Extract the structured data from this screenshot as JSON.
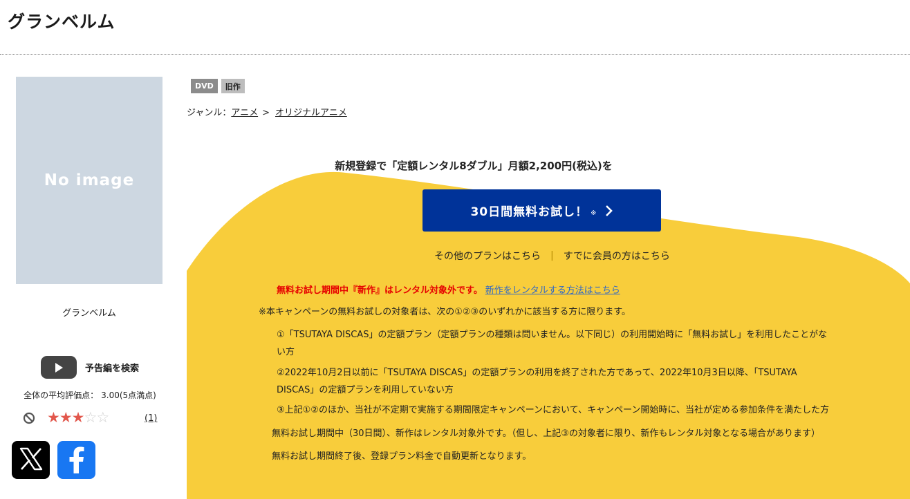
{
  "header": {
    "title": "グランベルム"
  },
  "product": {
    "no_image_text": "No image",
    "name": "グランベルム",
    "trailer_label": "予告編を検索",
    "avg_rating_label": "全体の平均評価点：",
    "avg_rating_value": "3.00(5点満点)",
    "rating": 3,
    "rating_max": 5,
    "review_count": "(1)"
  },
  "badges": {
    "format": "DVD",
    "age": "旧作"
  },
  "genre": {
    "label": "ジャンル：",
    "level1": "アニメ",
    "separator": ">",
    "level2": "オリジナルアニメ"
  },
  "campaign": {
    "headline": "新規登録で「定額レンタル8ダブル」月額2,200円(税込)を",
    "trial_button_label": "30日間無料お試し！",
    "trial_button_note": "※",
    "other_plans_link": "その他のプランはこちら",
    "divider": "|",
    "member_link": "すでに会員の方はこちら",
    "notice_red": "無料お試し期間中『新作』はレンタル対象外です。",
    "notice_link": "新作をレンタルする方法はこちら",
    "conditions_intro": "※本キャンペーンの無料お試しの対象者は、次の①②③のいずれかに該当する方に限ります。",
    "conditions": [
      "①「TSUTAYA DISCAS」の定額プラン（定額プランの種類は問いません。以下同じ）の利用開始時に「無料お試し」を利用したことがない方",
      "②2022年10月2日以前に「TSUTAYA DISCAS」の定額プランの利用を終了された方であって、2022年10月3日以降、「TSUTAYA DISCAS」の定額プランを利用していない方",
      "③上記①②のほか、当社が不定期で実施する期間限定キャンペーンにおいて、キャンペーン開始時に、当社が定める参加条件を満たした方"
    ],
    "notes": [
      "無料お試し期間中（30日間）、新作はレンタル対象外です。（但し、上記③の対象者に限り、新作もレンタル対象となる場合があります）",
      "無料お試し期間終了後、登録プラン料金で自動更新となります。"
    ]
  },
  "colors": {
    "campaign_yellow": "#f8cd3b",
    "button_blue": "#003399",
    "notice_red": "#e60000",
    "link_blue": "#2d67c8",
    "star_on": "#e2574c",
    "x_black": "#000000",
    "facebook_blue": "#1877f2"
  },
  "icons": [
    "youtube-play-icon",
    "no-sign-icon",
    "star-icon",
    "chevron-right-icon",
    "x-logo-icon",
    "facebook-logo-icon"
  ]
}
